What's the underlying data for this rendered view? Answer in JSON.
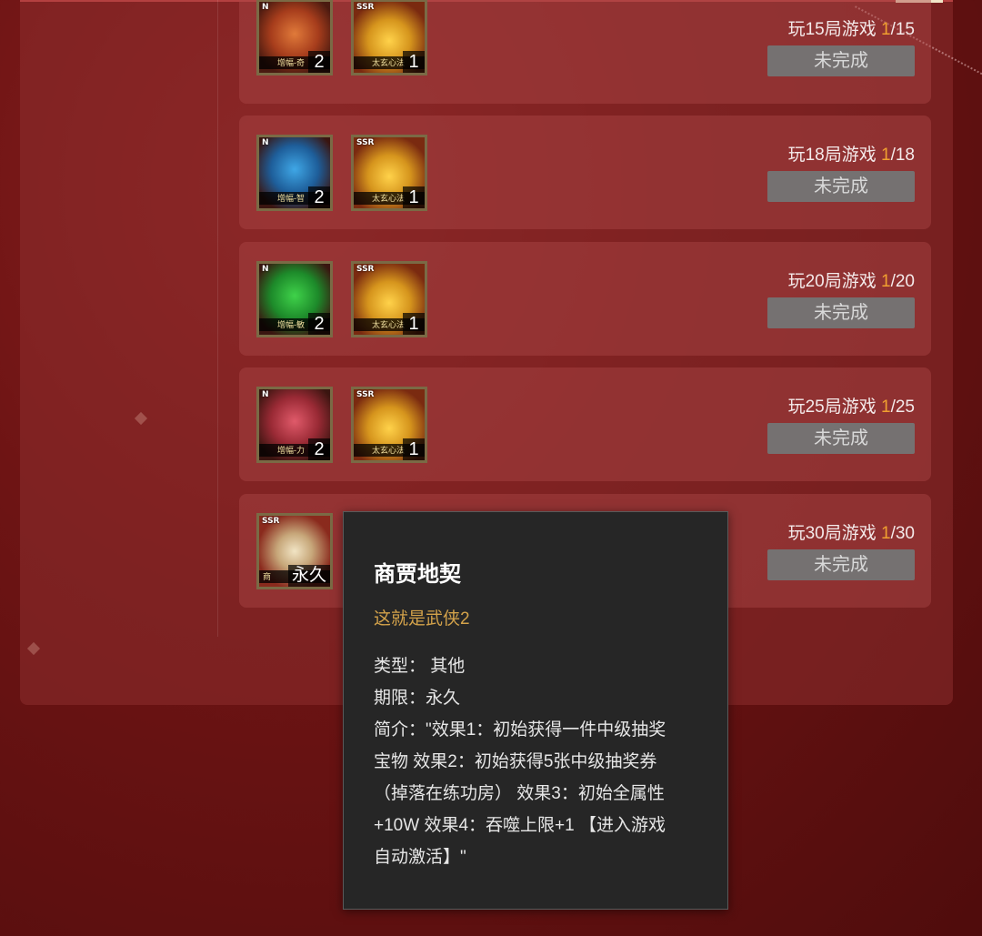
{
  "tasks": [
    {
      "progress_label": "玩15局游戏",
      "current": "1",
      "target": "/15",
      "button": "未完成",
      "rewards": [
        {
          "rarity": "N",
          "name": "增幅-奇",
          "count": "2",
          "icon": "orange-gem-icon"
        },
        {
          "rarity": "SSR",
          "name": "太玄心法",
          "count": "1",
          "icon": "golden-buddha-icon"
        }
      ]
    },
    {
      "progress_label": "玩18局游戏",
      "current": "1",
      "target": "/18",
      "button": "未完成",
      "rewards": [
        {
          "rarity": "N",
          "name": "增幅-智",
          "count": "2",
          "icon": "blue-gem-icon"
        },
        {
          "rarity": "SSR",
          "name": "太玄心法",
          "count": "1",
          "icon": "golden-buddha-icon"
        }
      ]
    },
    {
      "progress_label": "玩20局游戏",
      "current": "1",
      "target": "/20",
      "button": "未完成",
      "rewards": [
        {
          "rarity": "N",
          "name": "增幅-敏",
          "count": "2",
          "icon": "green-gem-icon"
        },
        {
          "rarity": "SSR",
          "name": "太玄心法",
          "count": "1",
          "icon": "golden-buddha-icon"
        }
      ]
    },
    {
      "progress_label": "玩25局游戏",
      "current": "1",
      "target": "/25",
      "button": "未完成",
      "rewards": [
        {
          "rarity": "N",
          "name": "增幅-力",
          "count": "2",
          "icon": "red-gem-icon"
        },
        {
          "rarity": "SSR",
          "name": "太玄心法",
          "count": "1",
          "icon": "golden-buddha-icon"
        }
      ]
    },
    {
      "progress_label": "玩30局游戏",
      "current": "1",
      "target": "/30",
      "button": "未完成",
      "rewards": [
        {
          "rarity": "SSR",
          "name": "商",
          "count": "永久",
          "icon": "book-icon"
        }
      ]
    }
  ],
  "tooltip": {
    "title": "商贾地契",
    "subtitle": "这就是武侠2",
    "lines": [
      "类型： 其他",
      "期限：永久",
      "简介：\"效果1：初始获得一件中级抽奖",
      "宝物 效果2：初始获得5张中级抽奖券",
      "（掉落在练功房） 效果3：初始全属性",
      "+10W 效果4：吞噬上限+1 【进入游戏",
      "自动激活】\""
    ]
  },
  "colors": {
    "current_progress": "#f0a030",
    "button_bg": "#757171",
    "tooltip_subtitle": "#d3a24a"
  }
}
